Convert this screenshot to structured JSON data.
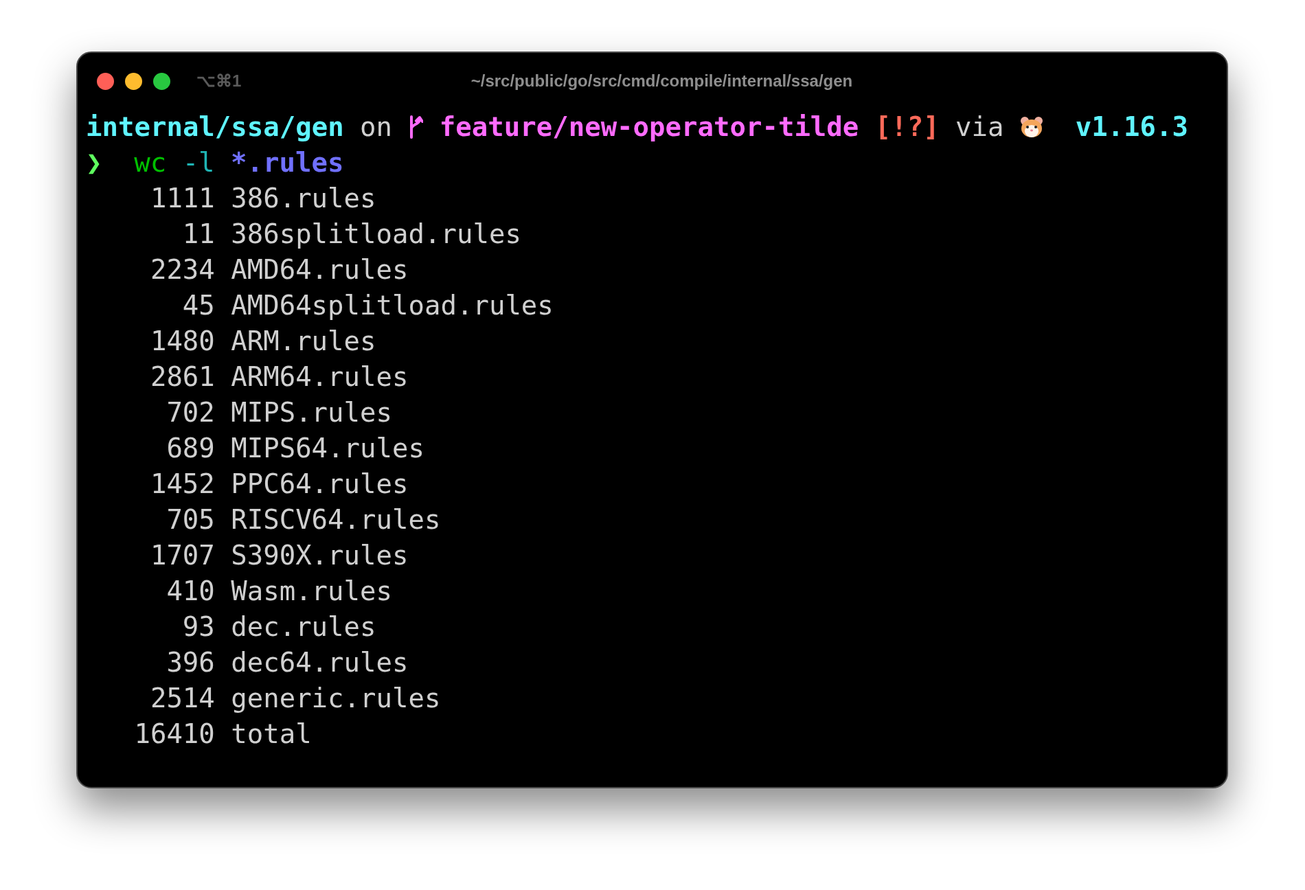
{
  "window": {
    "shortcut": "⌥⌘1",
    "title": "~/src/public/go/src/cmd/compile/internal/ssa/gen"
  },
  "prompt": {
    "directory": "internal/ssa/gen",
    "on": "on",
    "branch": "feature/new-operator-tilde",
    "status": "[!?]",
    "via": "via",
    "version": "v1.16.3"
  },
  "command": {
    "symbol": "❯",
    "program": "wc",
    "flag": "-l",
    "argument": "*.rules"
  },
  "output": [
    {
      "count": "1111",
      "file": "386.rules"
    },
    {
      "count": "11",
      "file": "386splitload.rules"
    },
    {
      "count": "2234",
      "file": "AMD64.rules"
    },
    {
      "count": "45",
      "file": "AMD64splitload.rules"
    },
    {
      "count": "1480",
      "file": "ARM.rules"
    },
    {
      "count": "2861",
      "file": "ARM64.rules"
    },
    {
      "count": "702",
      "file": "MIPS.rules"
    },
    {
      "count": "689",
      "file": "MIPS64.rules"
    },
    {
      "count": "1452",
      "file": "PPC64.rules"
    },
    {
      "count": "705",
      "file": "RISCV64.rules"
    },
    {
      "count": "1707",
      "file": "S390X.rules"
    },
    {
      "count": "410",
      "file": "Wasm.rules"
    },
    {
      "count": "93",
      "file": "dec.rules"
    },
    {
      "count": "396",
      "file": "dec64.rules"
    },
    {
      "count": "2514",
      "file": "generic.rules"
    },
    {
      "count": "16410",
      "file": "total"
    }
  ]
}
